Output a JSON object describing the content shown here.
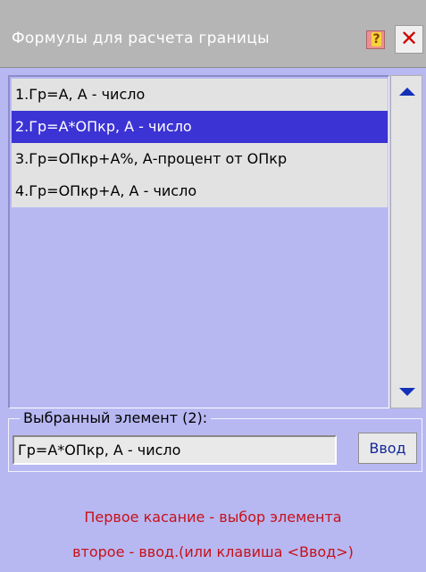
{
  "window": {
    "title": "Формулы для расчета границы",
    "close_label": "✕",
    "help_label": "?"
  },
  "list": {
    "items": [
      {
        "label": "1.Гр=А, А - число",
        "selected": false
      },
      {
        "label": "2.Гр=А*ОПкр, А - число",
        "selected": true
      },
      {
        "label": "3.Гр=ОПкр+А%, А-процент от ОПкр",
        "selected": false
      },
      {
        "label": "4.Гр=ОПкр+А, А - число",
        "selected": false
      }
    ]
  },
  "selection": {
    "group_label": "Выбранный элемент (2):",
    "value": "Гр=А*ОПкр, А - число",
    "enter_label": "Ввод"
  },
  "hints": {
    "line1": "Первое касание - выбор элемента",
    "line2": "второе - ввод.(или клавиша <Ввод>)"
  },
  "colors": {
    "background": "#b7b8f2",
    "selected_item": "#3b33d4",
    "hint_text": "#c81018",
    "accent_arrows": "#1230b8"
  },
  "icons": {
    "help": "help-icon",
    "close": "close-icon",
    "scroll_up": "arrow-up-icon",
    "scroll_down": "arrow-down-icon"
  }
}
